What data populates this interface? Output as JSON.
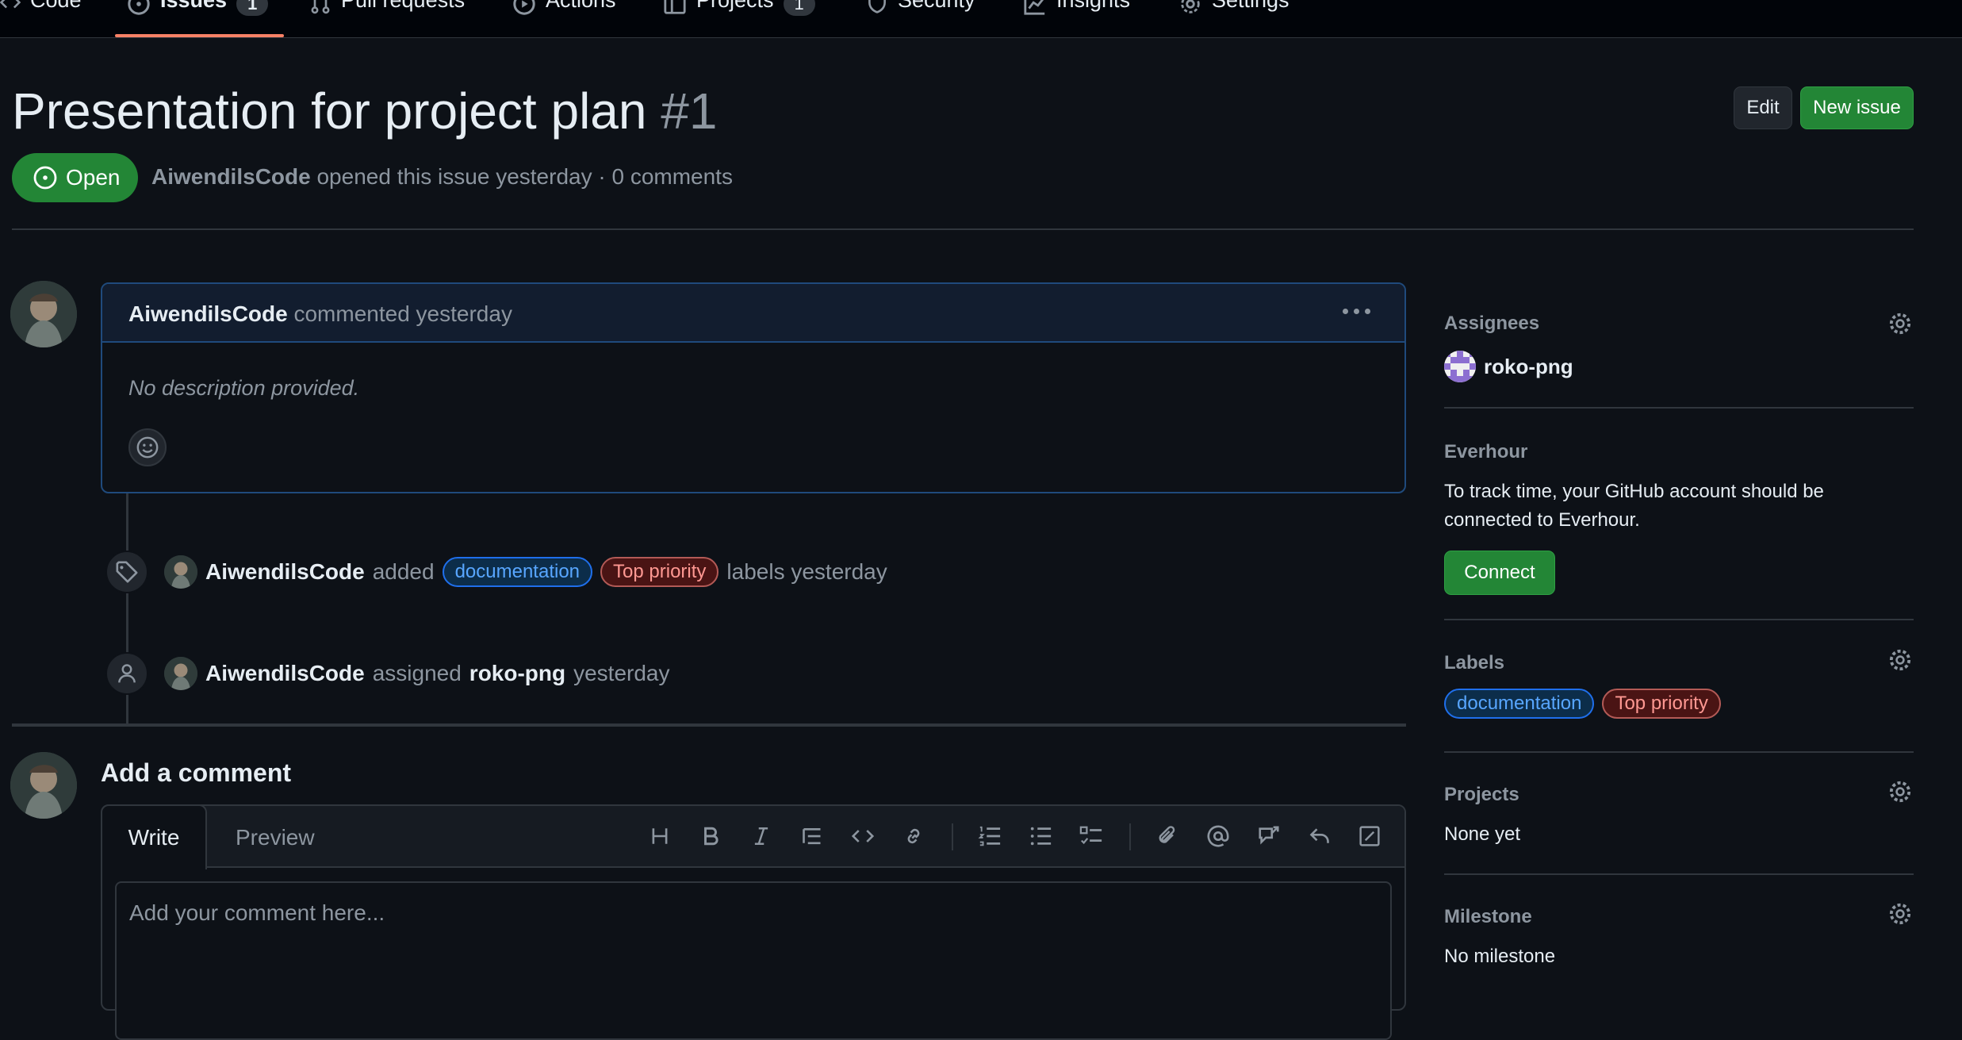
{
  "nav": {
    "tabs": [
      {
        "label": "Code",
        "icon": "code-icon"
      },
      {
        "label": "Issues",
        "count": "1",
        "icon": "issue-opened-icon",
        "active": true
      },
      {
        "label": "Pull requests",
        "icon": "git-pull-request-icon"
      },
      {
        "label": "Actions",
        "icon": "play-icon"
      },
      {
        "label": "Projects",
        "count": "1",
        "icon": "table-icon"
      },
      {
        "label": "Security",
        "icon": "shield-icon"
      },
      {
        "label": "Insights",
        "icon": "graph-icon"
      },
      {
        "label": "Settings",
        "icon": "gear-icon"
      }
    ]
  },
  "issue": {
    "title": "Presentation for project plan",
    "number": "#1",
    "state": "Open",
    "author": "AiwendilsCode",
    "meta_text": "opened this issue yesterday · 0 comments",
    "edit_label": "Edit",
    "new_issue_label": "New issue"
  },
  "comment": {
    "author": "AiwendilsCode",
    "action": "commented yesterday",
    "body": "No description provided."
  },
  "timeline": {
    "labels_event": {
      "actor": "AiwendilsCode",
      "verb": "added",
      "suffix": "labels yesterday"
    },
    "assign_event": {
      "actor": "AiwendilsCode",
      "verb": "assigned",
      "target": "roko-png",
      "suffix": "yesterday"
    }
  },
  "labels": [
    {
      "name": "documentation",
      "color": "#1f6feb"
    },
    {
      "name": "Top priority",
      "color": "#b35a56"
    }
  ],
  "new_comment": {
    "heading": "Add a comment",
    "tab_write": "Write",
    "tab_preview": "Preview",
    "placeholder": "Add your comment here..."
  },
  "sidebar": {
    "assignees": {
      "heading": "Assignees",
      "user": "roko-png"
    },
    "everhour": {
      "heading": "Everhour",
      "text": "To track time, your GitHub account should be connected to Everhour.",
      "button": "Connect"
    },
    "labels": {
      "heading": "Labels"
    },
    "projects": {
      "heading": "Projects",
      "value": "None yet"
    },
    "milestone": {
      "heading": "Milestone",
      "value": "No milestone"
    }
  },
  "colors": {
    "accent_green": "#238636",
    "tab_underline": "#f78166",
    "background": "#0d1117"
  }
}
